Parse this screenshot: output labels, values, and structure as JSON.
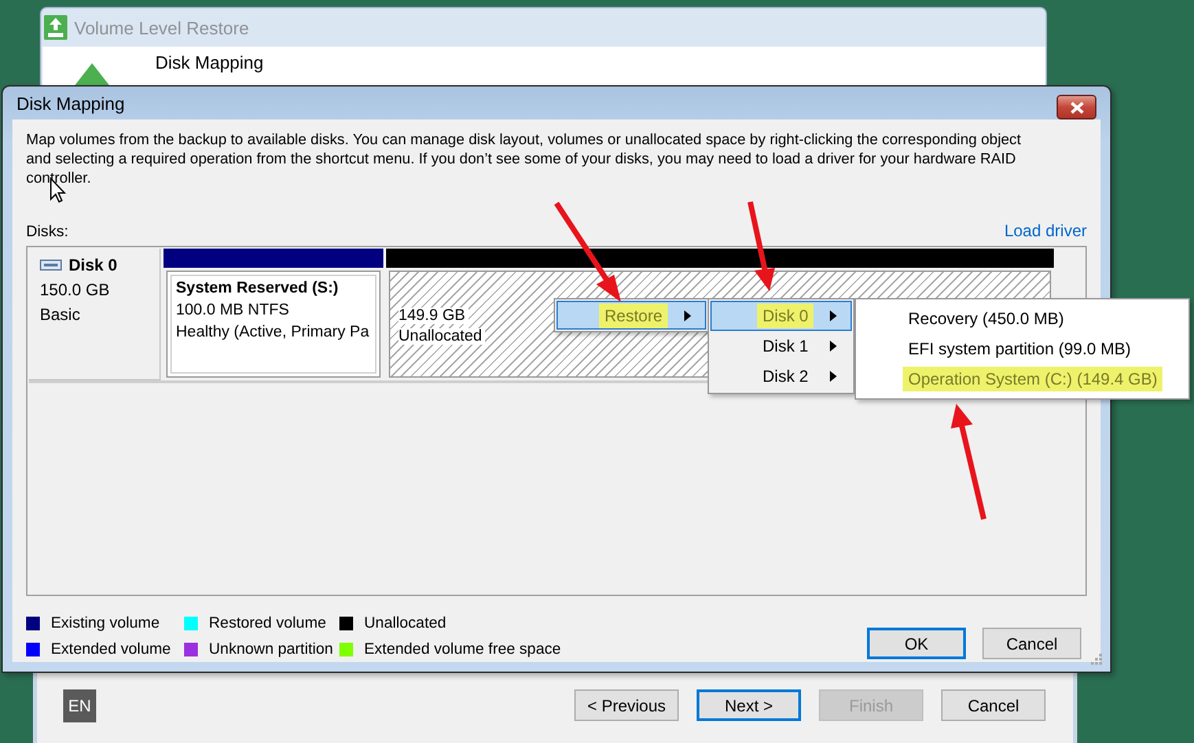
{
  "wizard": {
    "title": "Volume Level Restore",
    "step_title": "Disk Mapping",
    "language": "EN",
    "buttons": [
      {
        "label": "< Previous",
        "default": false,
        "disabled": false
      },
      {
        "label": "Next >",
        "default": true,
        "disabled": false
      },
      {
        "label": "Finish",
        "default": false,
        "disabled": true
      },
      {
        "label": "Cancel",
        "default": false,
        "disabled": false
      }
    ]
  },
  "dialog": {
    "title": "Disk Mapping",
    "description": "Map volumes from the backup to available disks. You can manage disk layout, volumes or unallocated space by right-clicking the corresponding object and selecting a required operation from the shortcut menu. If you don’t see some of your disks, you may need to load a driver for your hardware RAID controller.",
    "disks_label": "Disks:",
    "load_driver": "Load driver",
    "disks": [
      {
        "name": "Disk 0",
        "size": "150.0 GB",
        "type": "Basic",
        "volumes": [
          {
            "kind": "existing",
            "title": "System Reserved (S:)",
            "lines": [
              "100.0 MB NTFS",
              "Healthy (Active, Primary Pa"
            ]
          },
          {
            "kind": "unallocated",
            "lines": [
              "149.9 GB",
              "Unallocated"
            ]
          }
        ]
      }
    ],
    "legend": [
      {
        "label": "Existing volume",
        "color": "#000080"
      },
      {
        "label": "Extended volume",
        "color": "#0000ff"
      },
      {
        "label": "Restored volume",
        "color": "#00ffff"
      },
      {
        "label": "Unknown partition",
        "color": "#9a30e0"
      },
      {
        "label": "Unallocated",
        "color": "#000000"
      },
      {
        "label": "Extended volume free space",
        "color": "#80ff00"
      }
    ],
    "buttons": [
      {
        "label": "OK",
        "default": true
      },
      {
        "label": "Cancel",
        "default": false
      }
    ]
  },
  "menus": [
    {
      "items": [
        {
          "label": "Restore",
          "selected": true,
          "highlighted": true,
          "submenu": true
        }
      ]
    },
    {
      "items": [
        {
          "label": "Disk 0",
          "selected": true,
          "highlighted": true,
          "submenu": true
        },
        {
          "label": "Disk 1",
          "selected": false,
          "highlighted": false,
          "submenu": true
        },
        {
          "label": "Disk 2",
          "selected": false,
          "highlighted": false,
          "submenu": true
        }
      ]
    },
    {
      "items": [
        {
          "label": "Recovery (450.0 MB)",
          "selected": false,
          "highlighted": false,
          "submenu": false
        },
        {
          "label": "EFI system partition (99.0 MB)",
          "selected": false,
          "highlighted": false,
          "submenu": false
        },
        {
          "label": "Operation System (C:) (149.4 GB)",
          "selected": false,
          "highlighted": true,
          "submenu": false
        }
      ]
    }
  ]
}
